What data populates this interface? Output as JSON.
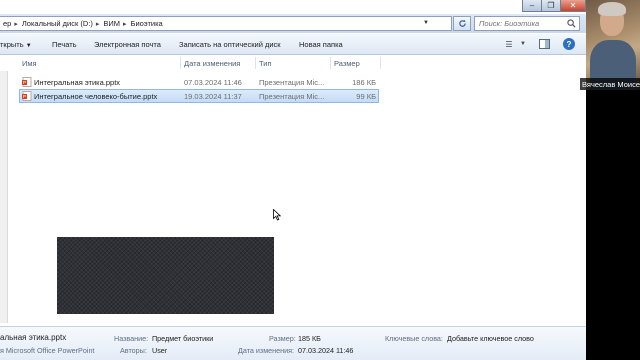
{
  "breadcrumb": {
    "items": [
      "ер",
      "Локальный диск (D:)",
      "ВИМ",
      "Биоэтика"
    ]
  },
  "search": {
    "placeholder": "Поиск: Биоэтика"
  },
  "toolbar": {
    "open_label": "ткрыть",
    "print_label": "Печать",
    "email_label": "Электронная почта",
    "burn_label": "Записать на оптический диск",
    "new_folder_label": "Новая папка"
  },
  "columns": {
    "name": "Имя",
    "date": "Дата изменения",
    "type": "Тип",
    "size": "Размер"
  },
  "files": [
    {
      "name": "Интегральная этика.pptx",
      "date": "07.03.2024 11:46",
      "type": "Презентация Mic...",
      "size": "186 КБ",
      "selected": false
    },
    {
      "name": "Интегральное человеко-бытие.pptx",
      "date": "19.03.2024 11:37",
      "type": "Презентация Mic...",
      "size": "99 КБ",
      "selected": true
    }
  ],
  "details": {
    "filename": "альная этика.pptx",
    "filetype": "я Microsoft Office PowerPoint",
    "title_label": "Название:",
    "title_value": "Предмет биоэтики",
    "authors_label": "Авторы:",
    "authors_value": "User",
    "size_label": "Размер:",
    "size_value": "185 КБ",
    "modified_label": "Дата изменения:",
    "modified_value": "07.03.2024 11:46",
    "keywords_label": "Ключевые слова:",
    "keywords_value": "Добавьте ключевое слово"
  },
  "webcam": {
    "name": "Вячеслав Моисе"
  },
  "colors": {
    "selection": "#cfe3fa",
    "accent": "#2e6fc0"
  }
}
